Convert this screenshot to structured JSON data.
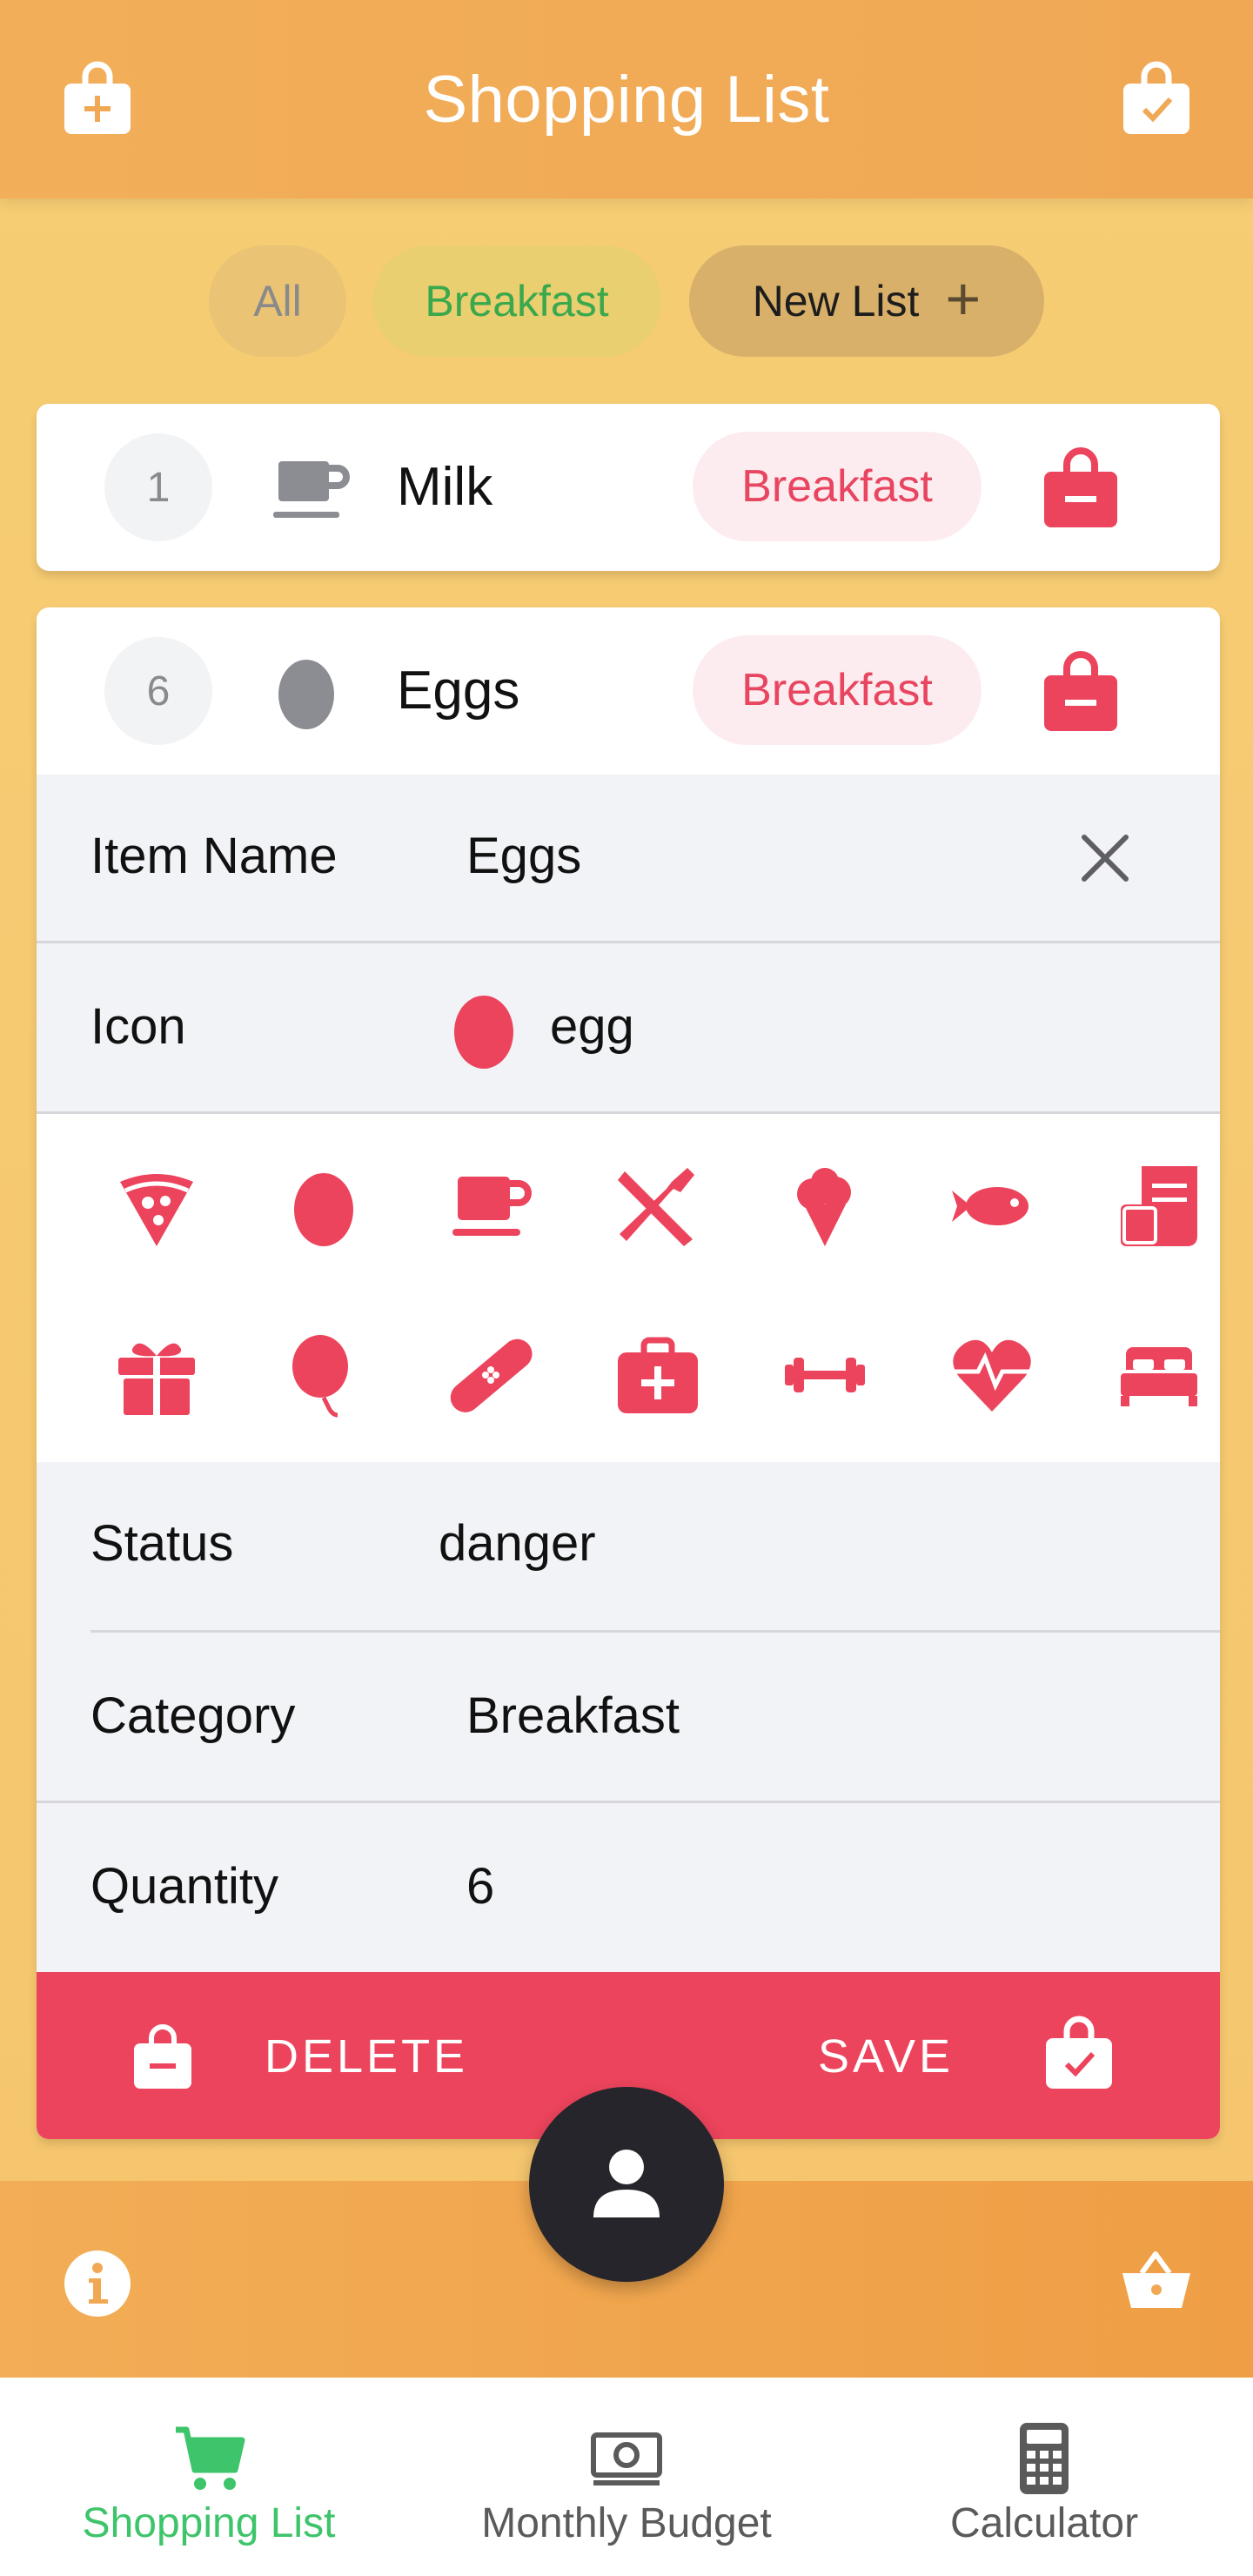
{
  "header": {
    "title": "Shopping List",
    "left_icon": "bag-add-icon",
    "right_icon": "bag-check-icon"
  },
  "filters": [
    {
      "label": "All",
      "state": "inactive"
    },
    {
      "label": "Breakfast",
      "state": "selected"
    },
    {
      "label": "New List",
      "icon": "plus-icon"
    }
  ],
  "items": [
    {
      "quantity": "1",
      "icon": "cup-icon",
      "name": "Milk",
      "category": "Breakfast"
    },
    {
      "quantity": "6",
      "icon": "egg-icon",
      "name": "Eggs",
      "category": "Breakfast"
    }
  ],
  "editor": {
    "item_name_label": "Item Name",
    "item_name_value": "Eggs",
    "icon_label": "Icon",
    "icon_value": "egg",
    "icon_choices": [
      "pizza-icon",
      "egg-icon",
      "cup-icon",
      "utensils-icon",
      "ice-cream-icon",
      "fish-icon",
      "receipt-icon",
      "gift-icon",
      "balloon-icon",
      "bandage-icon",
      "medkit-icon",
      "barbell-icon",
      "pulse-heart-icon",
      "bed-icon"
    ],
    "status_label": "Status",
    "status_value": "danger",
    "category_label": "Category",
    "category_value": "Breakfast",
    "quantity_label": "Quantity",
    "quantity_value": "6",
    "delete_label": "DELETE",
    "save_label": "SAVE"
  },
  "appbar": {
    "left_icon": "info-icon",
    "right_icon": "basket-icon",
    "fab_icon": "person-icon"
  },
  "bottom_nav": [
    {
      "label": "Shopping List",
      "icon": "cart-icon",
      "active": true
    },
    {
      "label": "Monthly Budget",
      "icon": "cash-icon",
      "active": false
    },
    {
      "label": "Calculator",
      "icon": "calculator-icon",
      "active": false
    }
  ],
  "colors": {
    "primary": "#f0a855",
    "danger": "#ec445c",
    "success": "#3ec46a",
    "background": "#f6cd74"
  }
}
